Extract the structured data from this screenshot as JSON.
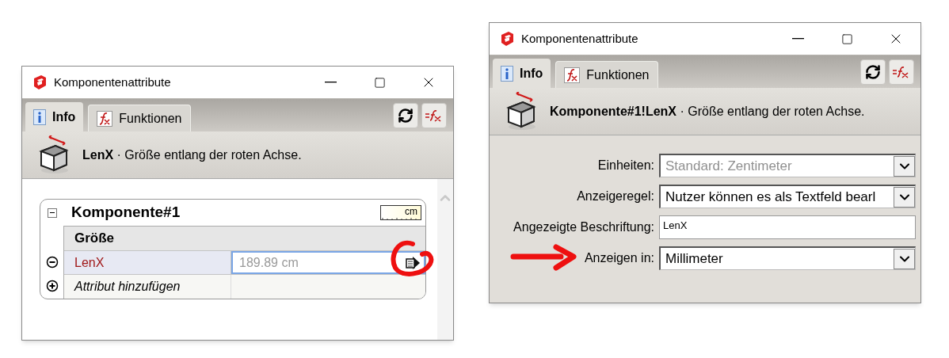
{
  "windows": [
    {
      "kind": "attributes",
      "title": "Komponentenattribute",
      "tabs": [
        {
          "label": "Info",
          "selected": true
        },
        {
          "label": "Funktionen",
          "selected": false
        }
      ],
      "header": {
        "name": "LenX",
        "description": " · Größe entlang der roten Achse."
      },
      "component": {
        "title": "Komponente#1",
        "expanded": true,
        "unit": "cm",
        "section": "Größe",
        "rows": [
          {
            "label": "LenX",
            "value": "189.89 cm",
            "highlighted": true
          }
        ],
        "add_label": "Attribut hinzufügen"
      }
    },
    {
      "kind": "options",
      "title": "Komponentenattribute",
      "tabs": [
        {
          "label": "Info",
          "selected": true
        },
        {
          "label": "Funktionen",
          "selected": false
        }
      ],
      "header": {
        "name": "Komponente#1!LenX",
        "description": " · Größe entlang der roten Achse."
      },
      "fields": [
        {
          "label": "Einheiten:",
          "kind": "select",
          "value": "Standard: Zentimeter",
          "disabled": true,
          "pointed": false
        },
        {
          "label": "Anzeigeregel:",
          "kind": "select",
          "value": "Nutzer können es als Textfeld bearl",
          "disabled": false,
          "pointed": false
        },
        {
          "label": "Angezeigte Beschriftung:",
          "kind": "text",
          "value": "LenX",
          "disabled": false,
          "pointed": false
        },
        {
          "label": "Anzeigen in:",
          "kind": "select",
          "value": "Millimeter",
          "disabled": false,
          "pointed": true
        }
      ]
    }
  ]
}
